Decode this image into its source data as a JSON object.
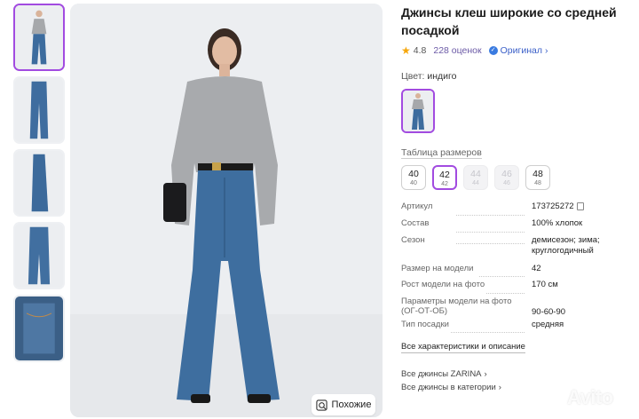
{
  "product": {
    "title": "Джинсы клеш широкие со средней посадкой",
    "rating": "4.8",
    "reviews": "228 оценок",
    "original_label": "Оригинал",
    "color_label": "Цвет:",
    "color_value": "индиго"
  },
  "gallery": {
    "thumbnails": [
      {
        "alt": "thumb-1",
        "active": true
      },
      {
        "alt": "thumb-2",
        "active": false
      },
      {
        "alt": "thumb-3",
        "active": false
      },
      {
        "alt": "thumb-4",
        "active": false
      },
      {
        "alt": "thumb-5",
        "active": false
      }
    ],
    "similar_button": "Похожие"
  },
  "sizes": {
    "link_label": "Таблица размеров",
    "items": [
      {
        "top": "40",
        "bottom": "40",
        "state": "available"
      },
      {
        "top": "42",
        "bottom": "42",
        "state": "selected"
      },
      {
        "top": "44",
        "bottom": "44",
        "state": "disabled"
      },
      {
        "top": "46",
        "bottom": "46",
        "state": "disabled"
      },
      {
        "top": "48",
        "bottom": "48",
        "state": "available"
      }
    ]
  },
  "specs": [
    {
      "key": "Артикул",
      "value": "173725272"
    },
    {
      "key": "Состав",
      "value": "100% хлопок"
    },
    {
      "key": "Сезон",
      "value": "демисезон; зима; круглогодичный"
    },
    {
      "key": "Размер на модели",
      "value": "42"
    },
    {
      "key": "Рост модели на фото",
      "value": "170 см"
    },
    {
      "key": "Параметры модели на фото (ОГ-ОТ-ОБ)",
      "value": "90-60-90"
    },
    {
      "key": "Тип посадки",
      "value": "средняя"
    }
  ],
  "links": {
    "all_specs": "Все характеристики и описание",
    "brand_all": "Все джинсы ZARINA",
    "category_all": "Все джинсы в категории"
  },
  "watermark": "Avito",
  "colors": {
    "accent": "#a24be0",
    "star": "#f6a609",
    "original": "#3a5fc8"
  }
}
